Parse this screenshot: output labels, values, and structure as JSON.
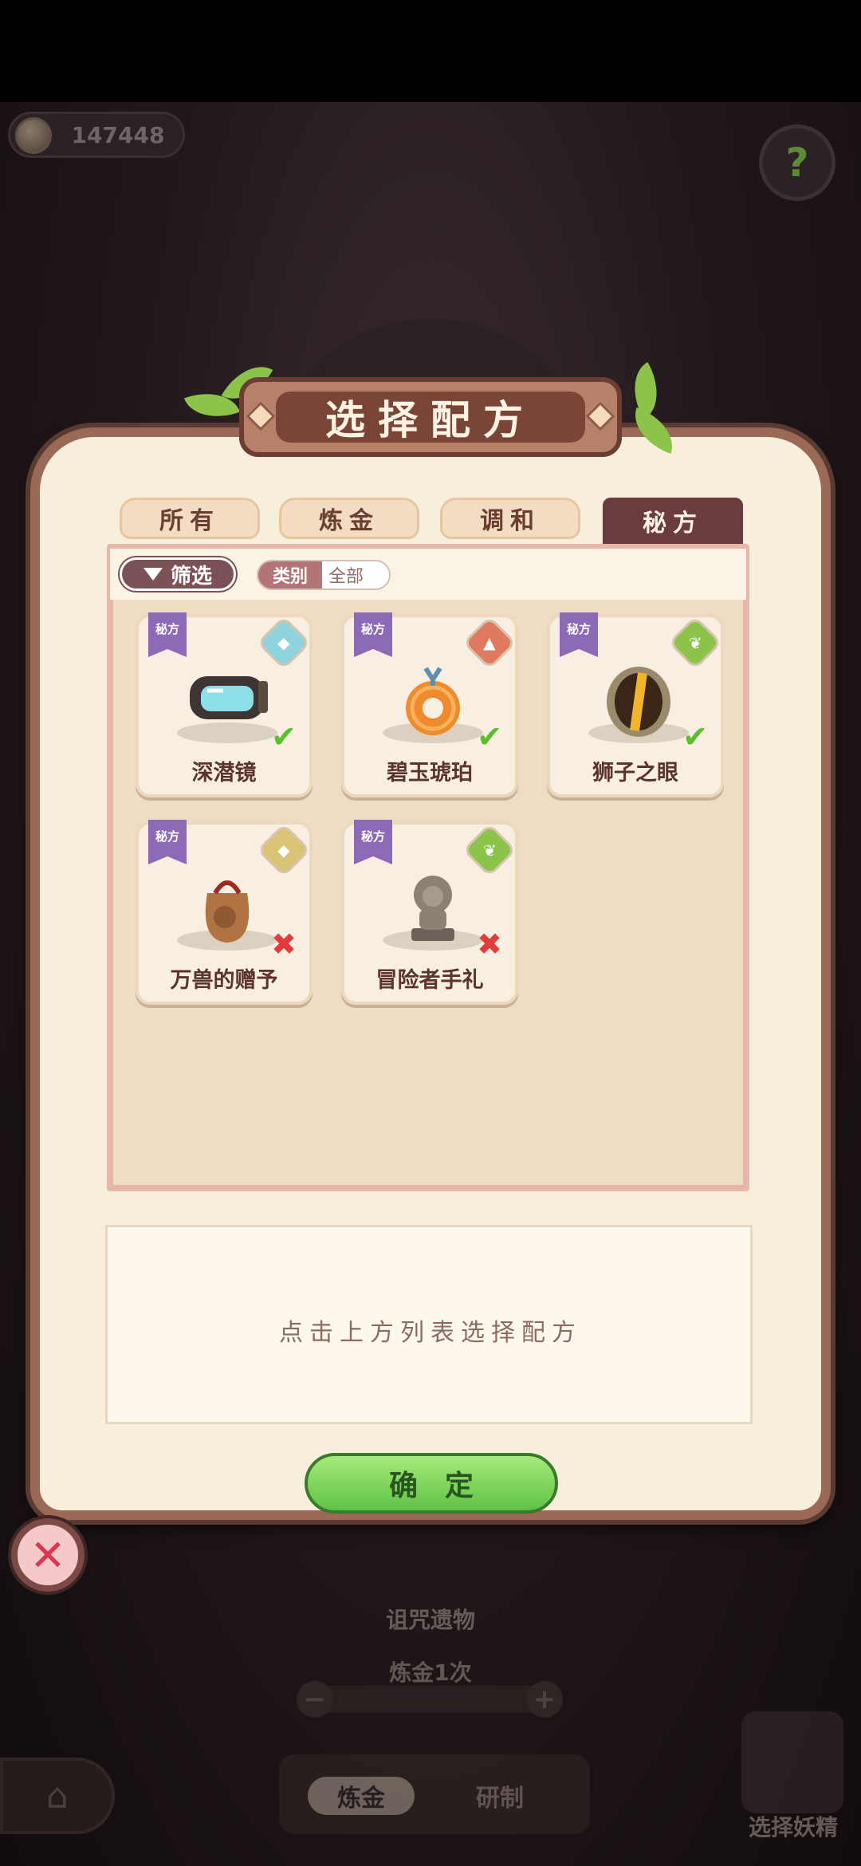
{
  "currency": {
    "value": "147448",
    "icon": "coin-icon"
  },
  "help_icon": "help-icon",
  "dialog": {
    "title": "选择配方",
    "tabs": [
      {
        "label": "所有",
        "active": false
      },
      {
        "label": "炼金",
        "active": false
      },
      {
        "label": "调和",
        "active": false
      },
      {
        "label": "秘方",
        "active": true
      }
    ],
    "filter": {
      "label": "筛选",
      "category_key": "类别",
      "category_value": "全部"
    },
    "recipes": [
      {
        "tag": "秘方",
        "name": "深潜镜",
        "element_color": "#8fd3dc",
        "status": "ok"
      },
      {
        "tag": "秘方",
        "name": "碧玉琥珀",
        "element_color": "#e07a5f",
        "status": "ok"
      },
      {
        "tag": "秘方",
        "name": "狮子之眼",
        "element_color": "#8cc34a",
        "status": "ok"
      },
      {
        "tag": "秘方",
        "name": "万兽的赠予",
        "element_color": "#d9c476",
        "status": "no"
      },
      {
        "tag": "秘方",
        "name": "冒险者手礼",
        "element_color": "#8cc34a",
        "status": "no"
      }
    ],
    "description": "点击上方列表选择配方",
    "confirm_label": "确定",
    "close_icon": "close-icon"
  },
  "background": {
    "card_label": "诅咒遗物",
    "count_text": "炼金1次",
    "tab_alchemy": "炼金",
    "tab_research": "研制",
    "select_fairy": "选择妖精"
  },
  "status_symbols": {
    "ok": "✔",
    "no": "✖"
  }
}
